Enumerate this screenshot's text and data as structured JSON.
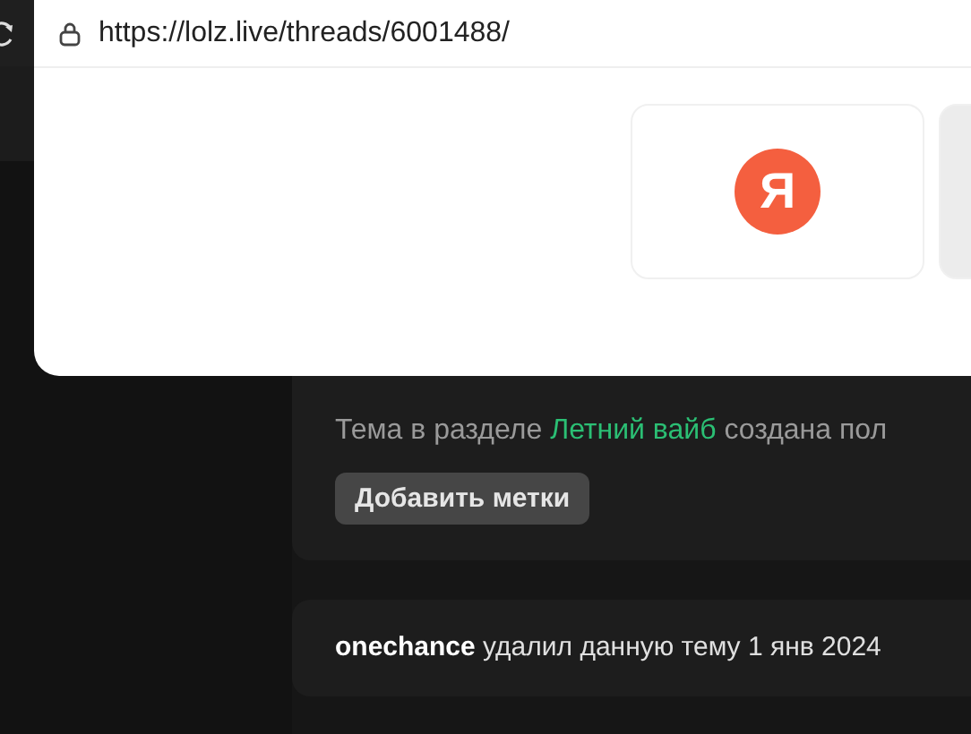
{
  "browser": {
    "url": "https://lolz.live/threads/6001488/"
  },
  "suggestions": [
    {
      "kind": "logo",
      "letter": "Я"
    },
    {
      "kind": "blank"
    }
  ],
  "thread": {
    "subtitle_prefix": "Тема в разделе",
    "section_link": "Летний вайб",
    "subtitle_suffix": "создана пол",
    "tag_button": "Добавить метки"
  },
  "notice": {
    "text": "**onechance** удалил данную тему 1 янв 2024"
  }
}
